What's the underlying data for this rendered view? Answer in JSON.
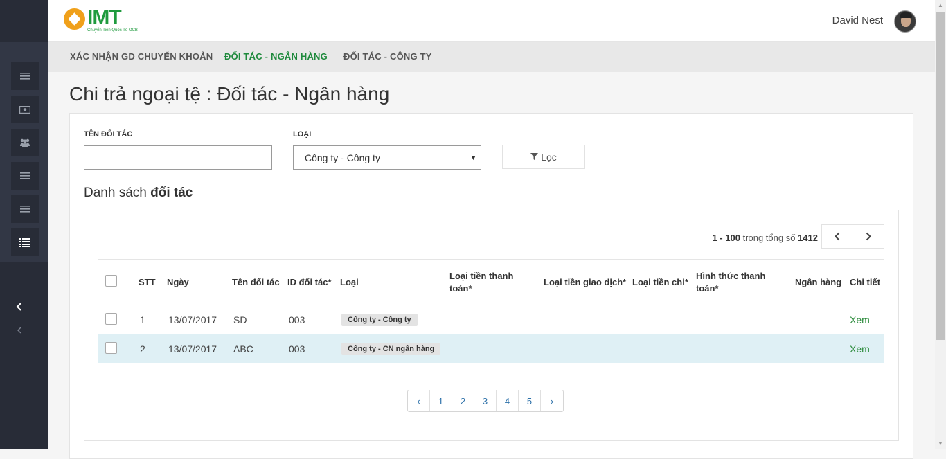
{
  "header": {
    "logo_text": "IMT",
    "logo_sub": "Chuyển Tiền Quốc Tế OCB",
    "user_name": "David Nest"
  },
  "tabs": [
    {
      "label": "XÁC NHẬN GD CHUYỂN KHOẢN"
    },
    {
      "label": "ĐỐI TÁC - NGÂN HÀNG"
    },
    {
      "label": "ĐỐI TÁC - CÔNG TY"
    }
  ],
  "page": {
    "title": "Chi trả ngoại tệ : Đối tác - Ngân hàng"
  },
  "filters": {
    "partner_name_label": "TÊN ĐỐI TÁC",
    "partner_name_value": "",
    "type_label": "LOẠI",
    "type_selected": "Công ty - Công ty",
    "filter_button": "Lọc"
  },
  "list": {
    "title_prefix": "Danh sách",
    "title_bold": "đối tác",
    "range": "1 - 100",
    "range_text": "trong tổng số",
    "total": "1412"
  },
  "table": {
    "columns": [
      "STT",
      "Ngày",
      "Tên đối tác",
      "ID đối tác*",
      "Loại",
      "Loại tiền thanh toán*",
      "Loại tiền giao dịch*",
      "Loại tiền chi*",
      "Hình thức thanh toán*",
      "Ngân hàng",
      "Chi tiết"
    ],
    "rows": [
      {
        "stt": "1",
        "date": "13/07/2017",
        "name": "SD",
        "id": "003",
        "type": "Công ty - Công ty",
        "detail": "Xem"
      },
      {
        "stt": "2",
        "date": "13/07/2017",
        "name": "ABC",
        "id": "003",
        "type": "Công ty - CN ngân hàng",
        "detail": "Xem"
      }
    ]
  },
  "pagination": {
    "prev": "‹",
    "pages": [
      "1",
      "2",
      "3",
      "4",
      "5"
    ],
    "next": "›"
  }
}
